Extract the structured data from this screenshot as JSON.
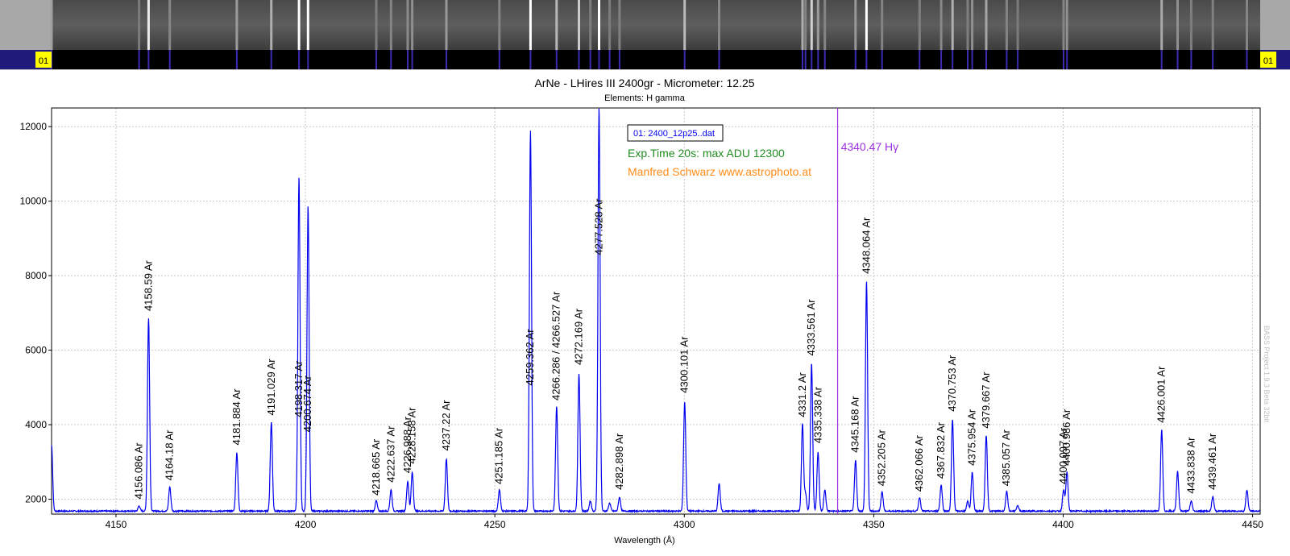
{
  "strip": {
    "left_marker": "01",
    "right_marker": "01"
  },
  "chart_data": {
    "type": "line",
    "title": "ArNe - LHires III 2400gr - Micrometer: 12.25",
    "subtitle": "Elements: H gamma",
    "xlabel": "Wavelength (Å)",
    "ylabel": "",
    "xlim": [
      4133,
      4452
    ],
    "ylim": [
      1600,
      12500
    ],
    "grid": true,
    "x_ticks": [
      4150,
      4200,
      4250,
      4300,
      4350,
      4400,
      4450
    ],
    "y_ticks": [
      2000,
      4000,
      6000,
      8000,
      10000,
      12000
    ],
    "series": [
      {
        "name": "01: 2400_12p25..dat",
        "color": "#0000ee"
      }
    ],
    "baseline": 1680,
    "peaks": [
      {
        "x": 4133.0,
        "y": 3450
      },
      {
        "x": 4156.1,
        "y": 1820
      },
      {
        "x": 4158.6,
        "y": 6850
      },
      {
        "x": 4164.2,
        "y": 2330
      },
      {
        "x": 4181.9,
        "y": 3250
      },
      {
        "x": 4191.0,
        "y": 4080
      },
      {
        "x": 4198.3,
        "y": 10650
      },
      {
        "x": 4200.7,
        "y": 9870
      },
      {
        "x": 4218.7,
        "y": 1960
      },
      {
        "x": 4222.6,
        "y": 2250
      },
      {
        "x": 4227.0,
        "y": 2480
      },
      {
        "x": 4228.2,
        "y": 2720
      },
      {
        "x": 4237.2,
        "y": 3080
      },
      {
        "x": 4251.2,
        "y": 2250
      },
      {
        "x": 4259.4,
        "y": 11900
      },
      {
        "x": 4266.3,
        "y": 4480
      },
      {
        "x": 4272.2,
        "y": 5380
      },
      {
        "x": 4275.2,
        "y": 1950
      },
      {
        "x": 4277.5,
        "y": 12500
      },
      {
        "x": 4280.3,
        "y": 1900
      },
      {
        "x": 4282.9,
        "y": 2050
      },
      {
        "x": 4300.1,
        "y": 4620
      },
      {
        "x": 4309.2,
        "y": 2420
      },
      {
        "x": 4331.2,
        "y": 4020
      },
      {
        "x": 4332.0,
        "y": 2150
      },
      {
        "x": 4333.6,
        "y": 5650
      },
      {
        "x": 4335.3,
        "y": 3270
      },
      {
        "x": 4337.1,
        "y": 2250
      },
      {
        "x": 4345.2,
        "y": 3050
      },
      {
        "x": 4348.1,
        "y": 7860
      },
      {
        "x": 4352.2,
        "y": 2200
      },
      {
        "x": 4362.1,
        "y": 2050
      },
      {
        "x": 4367.8,
        "y": 2380
      },
      {
        "x": 4370.8,
        "y": 4130
      },
      {
        "x": 4374.8,
        "y": 1950
      },
      {
        "x": 4376.0,
        "y": 2730
      },
      {
        "x": 4379.7,
        "y": 3720
      },
      {
        "x": 4385.1,
        "y": 2200
      },
      {
        "x": 4388.0,
        "y": 1820
      },
      {
        "x": 4400.1,
        "y": 2250
      },
      {
        "x": 4401.0,
        "y": 2730
      },
      {
        "x": 4426.0,
        "y": 3870
      },
      {
        "x": 4430.2,
        "y": 2750
      },
      {
        "x": 4433.8,
        "y": 1950
      },
      {
        "x": 4439.5,
        "y": 2070
      },
      {
        "x": 4448.5,
        "y": 2250
      }
    ],
    "line_labels": [
      {
        "x": 4156.086,
        "y": 2000,
        "text": "4156.086 Ar"
      },
      {
        "x": 4158.59,
        "y": 7050,
        "text": "4158.59 Ar"
      },
      {
        "x": 4164.18,
        "y": 2500,
        "text": "4164.18 Ar"
      },
      {
        "x": 4181.884,
        "y": 3450,
        "text": "4181.884 Ar"
      },
      {
        "x": 4191.029,
        "y": 4250,
        "text": "4191.029 Ar"
      },
      {
        "x": 4198.317,
        "y": 4200,
        "text": "4198.317 Ar"
      },
      {
        "x": 4200.674,
        "y": 3800,
        "text": "4200.674 Ar"
      },
      {
        "x": 4218.665,
        "y": 2100,
        "text": "4218.665 Ar"
      },
      {
        "x": 4222.637,
        "y": 2450,
        "text": "4222.637 Ar"
      },
      {
        "x": 4226.988,
        "y": 2700,
        "text": "4226.988 Ar"
      },
      {
        "x": 4228.158,
        "y": 2950,
        "text": "4228.158 Ar"
      },
      {
        "x": 4237.22,
        "y": 3300,
        "text": "4237.22 Ar"
      },
      {
        "x": 4251.185,
        "y": 2400,
        "text": "4251.185 Ar"
      },
      {
        "x": 4259.362,
        "y": 5050,
        "text": "4259.362 Ar"
      },
      {
        "x": 4266.286,
        "y": 4650,
        "text": "4266.286 /  4266.527 Ar"
      },
      {
        "x": 4272.169,
        "y": 5600,
        "text": "4272.169 Ar"
      },
      {
        "x": 4277.528,
        "y": 8550,
        "text": "4277.528 Ar"
      },
      {
        "x": 4282.898,
        "y": 2250,
        "text": "4282.898 Ar"
      },
      {
        "x": 4300.101,
        "y": 4850,
        "text": "4300.101 Ar"
      },
      {
        "x": 4331.2,
        "y": 4200,
        "text": "4331.2 Ar"
      },
      {
        "x": 4333.561,
        "y": 5850,
        "text": "4333.561 Ar"
      },
      {
        "x": 4335.338,
        "y": 3500,
        "text": "4335.338 Ar"
      },
      {
        "x": 4345.168,
        "y": 3250,
        "text": "4345.168 Ar"
      },
      {
        "x": 4348.064,
        "y": 8050,
        "text": "4348.064 Ar"
      },
      {
        "x": 4352.205,
        "y": 2350,
        "text": "4352.205 Ar"
      },
      {
        "x": 4362.066,
        "y": 2200,
        "text": "4362.066 Ar"
      },
      {
        "x": 4367.832,
        "y": 2550,
        "text": "4367.832 Ar"
      },
      {
        "x": 4370.753,
        "y": 4350,
        "text": "4370.753 Ar"
      },
      {
        "x": 4375.954,
        "y": 2900,
        "text": "4375.954 Ar"
      },
      {
        "x": 4379.667,
        "y": 3900,
        "text": "4379.667 Ar"
      },
      {
        "x": 4385.057,
        "y": 2350,
        "text": "4385.057 Ar"
      },
      {
        "x": 4400.097,
        "y": 2400,
        "text": "4400.097 Ar"
      },
      {
        "x": 4400.986,
        "y": 2900,
        "text": "4400.986 Ar"
      },
      {
        "x": 4426.001,
        "y": 4050,
        "text": "4426.001 Ar"
      },
      {
        "x": 4433.838,
        "y": 2150,
        "text": "4433.838 Ar"
      },
      {
        "x": 4439.461,
        "y": 2250,
        "text": "4439.461 Ar"
      }
    ],
    "marker_line": {
      "x": 4340.47,
      "label": "4340.47 Hγ",
      "color": "#9b30e0"
    },
    "annotations": {
      "legend_label": "01: 2400_12p25..dat",
      "exposure": "Exp.Time 20s: max ADU 12300",
      "author": "Manfred Schwarz www.astrophoto.at",
      "watermark": "BASS Project 1.9.3 Beta 32bit"
    },
    "colors": {
      "series": "#0000ee",
      "exposure": "#228b22",
      "author": "#ff8c1a",
      "marker": "#9b30e0",
      "watermark": "#c0c0c0"
    }
  }
}
